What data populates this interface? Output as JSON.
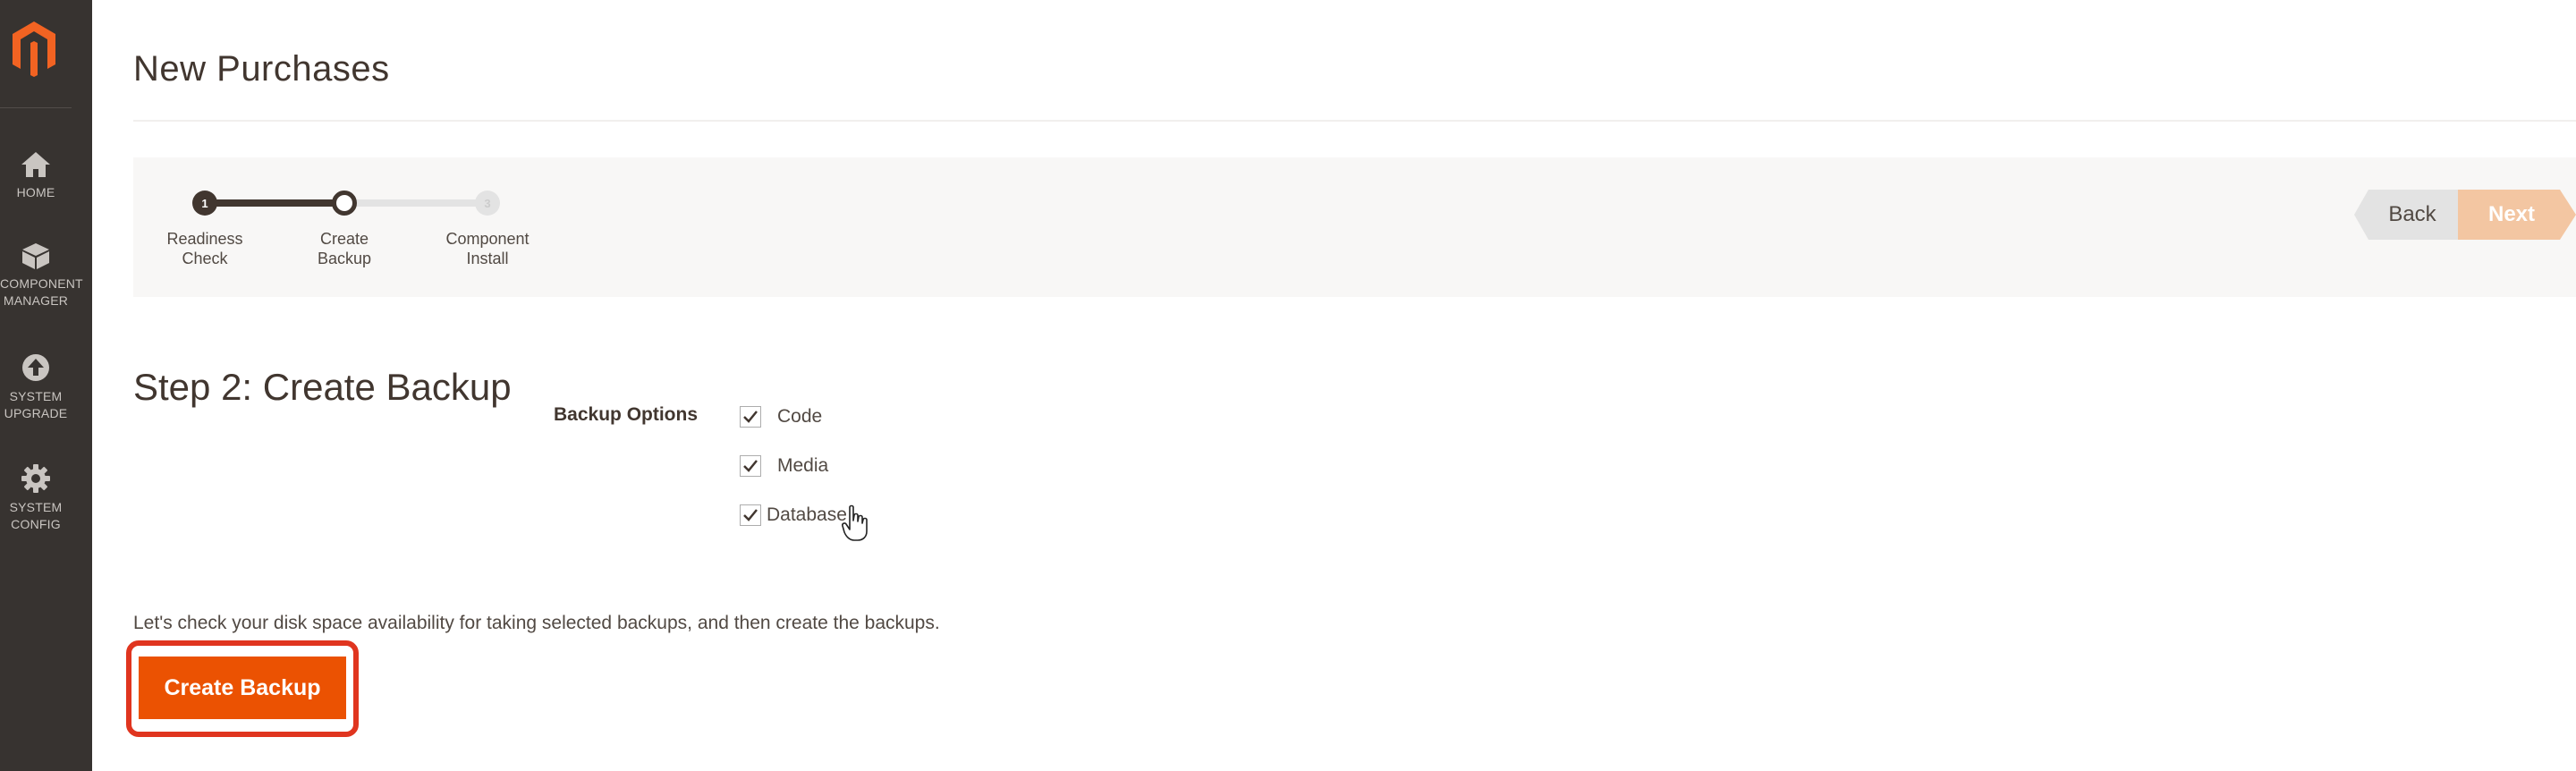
{
  "sidebar": {
    "logo": "magento-logo",
    "items": [
      {
        "icon": "home-icon",
        "label_lines": [
          "HOME"
        ]
      },
      {
        "icon": "cube-icon",
        "label_lines": [
          "COMPONENT",
          "MANAGER"
        ]
      },
      {
        "icon": "upgrade-arrow-icon",
        "label_lines": [
          "SYSTEM",
          "UPGRADE"
        ]
      },
      {
        "icon": "gear-icon",
        "label_lines": [
          "SYSTEM",
          "CONFIG"
        ]
      }
    ]
  },
  "page": {
    "title": "New Purchases"
  },
  "wizard": {
    "steps": [
      {
        "number": "1",
        "label_lines": [
          "Readiness",
          "Check"
        ],
        "state": "done"
      },
      {
        "number": "2",
        "label_lines": [
          "Create",
          "Backup"
        ],
        "state": "active"
      },
      {
        "number": "3",
        "label_lines": [
          "Component",
          "Install"
        ],
        "state": "pending"
      }
    ],
    "back_label": "Back",
    "next_label": "Next"
  },
  "backup": {
    "heading": "Step 2: Create Backup",
    "options_label": "Backup Options",
    "options": [
      {
        "label": "Code",
        "checked": true
      },
      {
        "label": "Media",
        "checked": true
      },
      {
        "label": "Database",
        "checked": true
      }
    ],
    "info_text": "Let's check your disk space availability for taking selected backups, and then create the backups.",
    "create_button_label": "Create Backup"
  },
  "colors": {
    "sidebar_bg": "#373330",
    "accent_orange": "#eb5202",
    "next_disabled": "#f3c6a2",
    "highlight_red": "#e0351f",
    "text_dark": "#41362f"
  }
}
